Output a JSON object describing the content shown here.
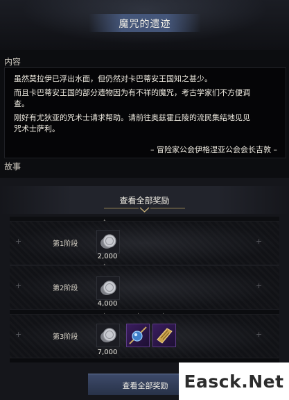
{
  "header": {
    "title": "魔咒的遗迹"
  },
  "content": {
    "label": "内容",
    "paragraphs": [
      "虽然莫拉伊已浮出水面，但仍然对卡巴蒂安王国知之甚少。",
      "而且卡巴蒂安王国的部分遗物因为有不祥的魔咒，考古学家们不方便调",
      "查。",
      "刚好有尤狄亚的咒术士请求帮助。请前往奥兹霍丘陵的流民集结地见见",
      "咒术士萨利。"
    ],
    "signature": "– 冒险家公会伊格涅亚公会会长吉敦 –"
  },
  "story": {
    "label": "故事",
    "reward_header": "查看全部奖励",
    "stages": [
      {
        "label": "第1阶段",
        "amount": "2,000"
      },
      {
        "label": "第2阶段",
        "amount": "4,000"
      },
      {
        "label": "第3阶段",
        "amount": "7,000"
      }
    ],
    "button_label": "查看全部奖励"
  },
  "icons": {
    "coin": "silver-coin-icon",
    "diamond": "diamond-marker-icon",
    "plus": "plus-icon",
    "item1": "blue-orb-spear-icon",
    "item2": "golden-scroll-icon"
  },
  "colors": {
    "accent": "#46587d",
    "purple_item": "#3a1d5e"
  },
  "watermark": "Easck.Net"
}
